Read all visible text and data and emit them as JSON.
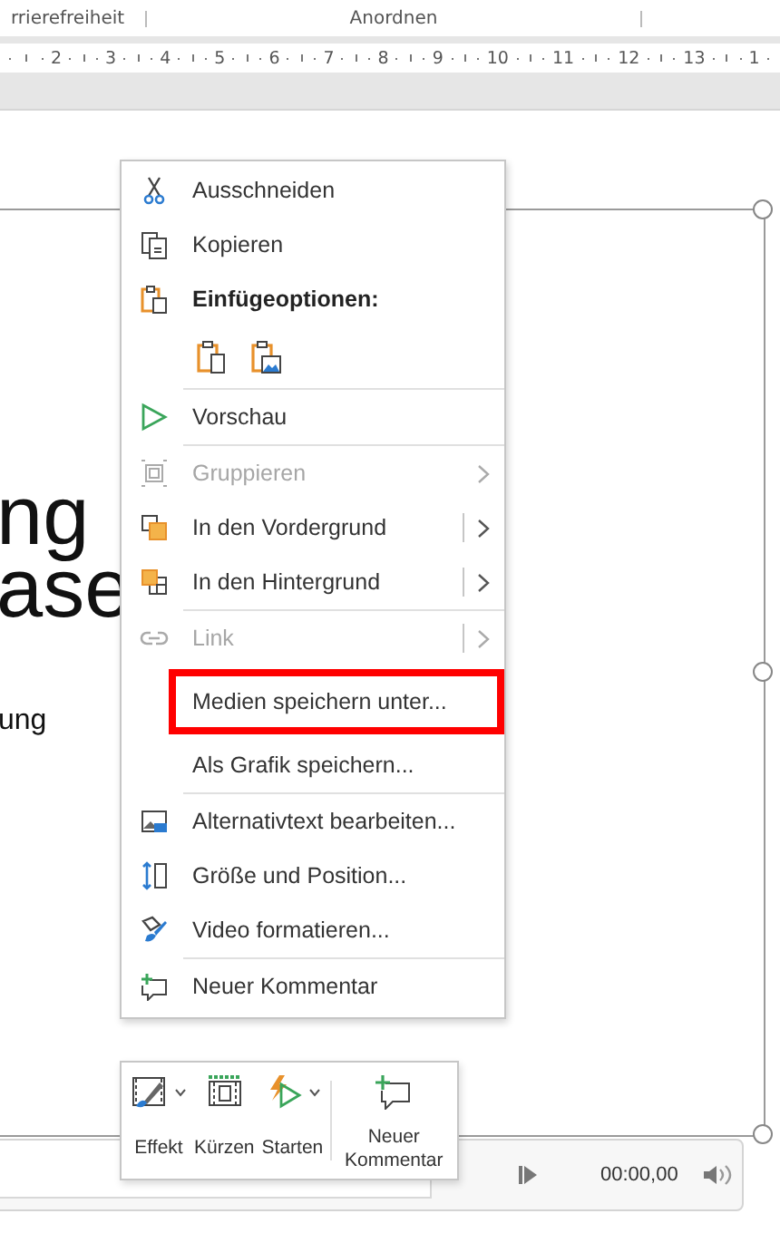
{
  "ribbon": {
    "groups": [
      {
        "label": "rrierefreiheit"
      },
      {
        "label": "Anordnen"
      }
    ]
  },
  "ruler": {
    "numbers": [
      "2",
      "3",
      "4",
      "5",
      "6",
      "7",
      "8",
      "9",
      "10",
      "11",
      "12",
      "13",
      "1"
    ]
  },
  "slide": {
    "title_lines": [
      "ng",
      "ase"
    ],
    "subtitle": "ung"
  },
  "context_menu": {
    "items": [
      {
        "kind": "command",
        "label": "Ausschneiden",
        "disabled": false,
        "submenu": false,
        "highlighted": false
      },
      {
        "kind": "command",
        "label": "Kopieren",
        "disabled": false,
        "submenu": false,
        "highlighted": false
      },
      {
        "kind": "header",
        "label": "Einfügeoptionen:"
      },
      {
        "kind": "paste_options",
        "options": [
          {
            "kind": "keep_format"
          },
          {
            "kind": "picture"
          }
        ]
      },
      {
        "kind": "separator"
      },
      {
        "kind": "command",
        "label": "Vorschau",
        "disabled": false,
        "submenu": false,
        "highlighted": false
      },
      {
        "kind": "separator"
      },
      {
        "kind": "command",
        "label": "Gruppieren",
        "disabled": true,
        "submenu": true,
        "split": false,
        "highlighted": false
      },
      {
        "kind": "command",
        "label": "In den Vordergrund",
        "disabled": false,
        "submenu": true,
        "split": true,
        "highlighted": false
      },
      {
        "kind": "command",
        "label": "In den Hintergrund",
        "disabled": false,
        "submenu": true,
        "split": true,
        "highlighted": false
      },
      {
        "kind": "separator"
      },
      {
        "kind": "command",
        "label": "Link",
        "disabled": true,
        "submenu": true,
        "split": true,
        "highlighted": false
      },
      {
        "kind": "command",
        "label": "Medien speichern unter...",
        "disabled": false,
        "submenu": false,
        "highlighted": true
      },
      {
        "kind": "command",
        "label": "Als Grafik speichern...",
        "disabled": false,
        "submenu": false,
        "highlighted": false
      },
      {
        "kind": "separator"
      },
      {
        "kind": "command",
        "label": "Alternativtext bearbeiten...",
        "disabled": false,
        "submenu": false,
        "highlighted": false
      },
      {
        "kind": "command",
        "label": "Größe und Position...",
        "disabled": false,
        "submenu": false,
        "highlighted": false
      },
      {
        "kind": "command",
        "label": "Video formatieren...",
        "disabled": false,
        "submenu": false,
        "highlighted": false
      },
      {
        "kind": "separator"
      },
      {
        "kind": "command",
        "label": "Neuer Kommentar",
        "disabled": false,
        "submenu": false,
        "highlighted": false
      }
    ]
  },
  "mini_toolbar": {
    "buttons": [
      {
        "label": "Effekt",
        "dropdown": true
      },
      {
        "label": "Kürzen",
        "dropdown": false
      },
      {
        "label": "Starten",
        "dropdown": true
      },
      {
        "label": "Neuer Kommentar",
        "dropdown": false
      }
    ]
  },
  "media_controls": {
    "time": "00:00,00"
  }
}
